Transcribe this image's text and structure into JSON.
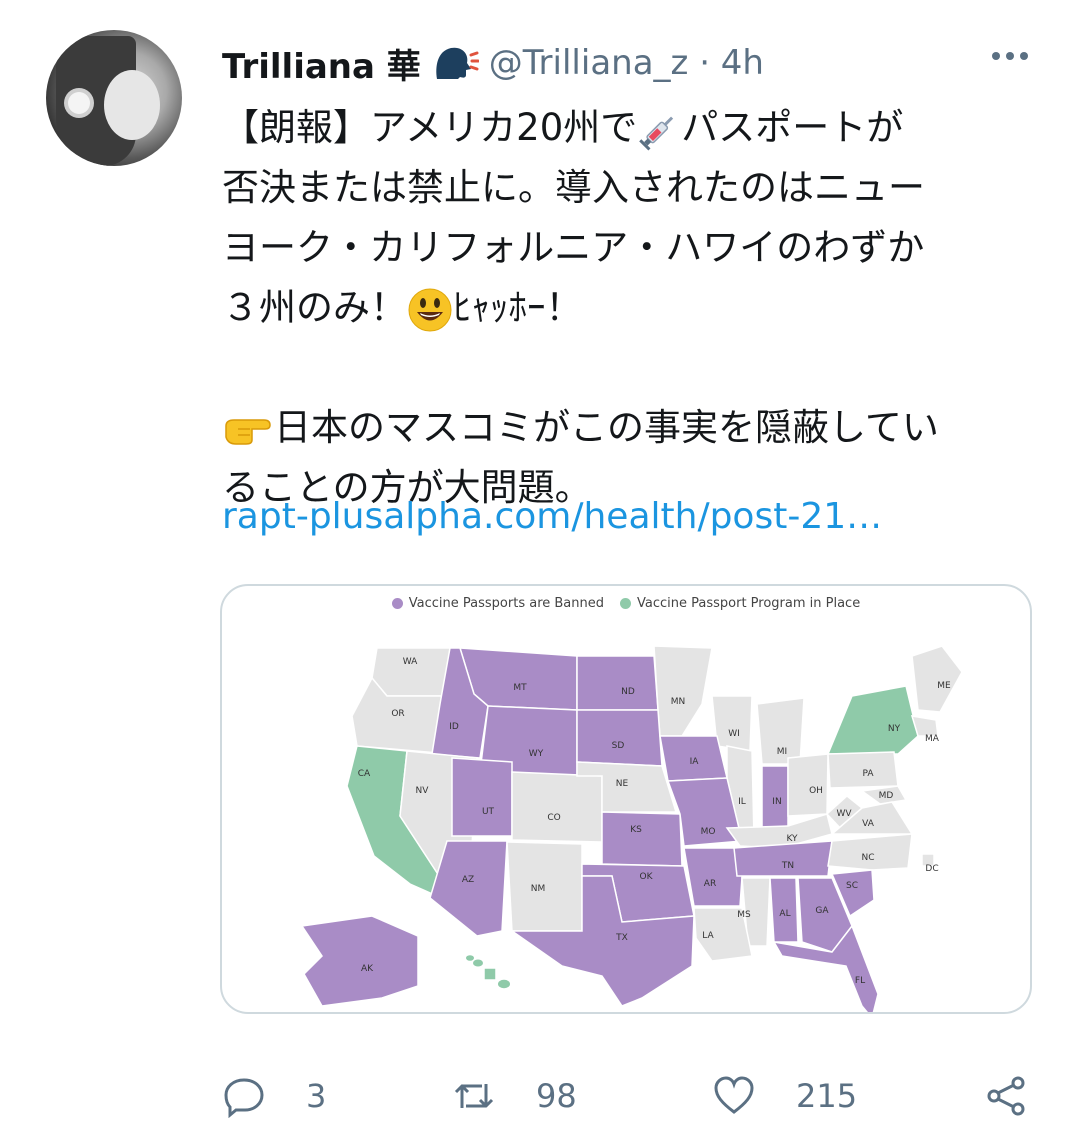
{
  "user": {
    "name": "Trilliana 華",
    "handle": "@Trilliana_z · 4h"
  },
  "tweet": {
    "lines": [
      "【朗報】アメリカ20州で",
      "パスポートが",
      "否決または禁止に。導入されたのはニュー",
      "ヨーク・カリフォルニア・ハワイのわずか",
      "３州のみ！",
      "ﾋｬｯﾎｰ！",
      "日本のマスコミがこの事実を隠蔽してい",
      "ることの方が大問題。"
    ],
    "link": "rapt-plusalpha.com/health/post-21…"
  },
  "map": {
    "legend": [
      {
        "label": "Vaccine Passports are Banned",
        "color": "#a98cc6"
      },
      {
        "label": "Vaccine Passport Program in Place",
        "color": "#8fcaa9"
      }
    ],
    "neutral_color": "#e4e4e4",
    "states": [
      "WA",
      "MT",
      "ND",
      "MN",
      "ME",
      "OR",
      "ID",
      "WY",
      "SD",
      "WI",
      "MI",
      "NY",
      "MA",
      "CA",
      "NV",
      "UT",
      "CO",
      "NE",
      "IA",
      "IL",
      "IN",
      "OH",
      "PA",
      "MD",
      "KS",
      "MO",
      "KY",
      "WV",
      "VA",
      "AZ",
      "NM",
      "OK",
      "AR",
      "TN",
      "NC",
      "SC",
      "DC",
      "TX",
      "MS",
      "AL",
      "GA",
      "LA",
      "FL",
      "AK",
      "HI"
    ],
    "banned": [
      "MT",
      "ND",
      "ID",
      "WY",
      "SD",
      "UT",
      "IA",
      "IN",
      "KS",
      "MO",
      "AZ",
      "OK",
      "AR",
      "TN",
      "SC",
      "TX",
      "AL",
      "GA",
      "FL",
      "AK"
    ],
    "program": [
      "NY",
      "CA",
      "HI"
    ]
  },
  "actions": {
    "replies": "3",
    "retweets": "98",
    "likes": "215"
  }
}
